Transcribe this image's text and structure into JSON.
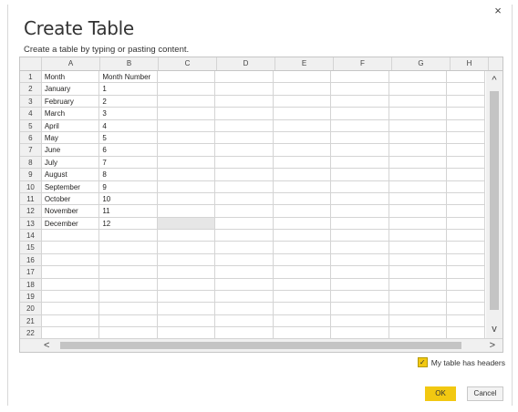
{
  "dialog": {
    "title": "Create Table",
    "subtitle": "Create a table by typing or pasting content.",
    "close_glyph": "×",
    "ok_label": "OK",
    "cancel_label": "Cancel",
    "headers_checkbox_label": "My table has headers",
    "headers_checked": true
  },
  "grid": {
    "columns": [
      "A",
      "B",
      "C",
      "D",
      "E",
      "F",
      "G",
      "H"
    ],
    "rows": [
      {
        "n": "1",
        "a": "Month",
        "b": "Month Number"
      },
      {
        "n": "2",
        "a": "January",
        "b": "1"
      },
      {
        "n": "3",
        "a": "February",
        "b": "2"
      },
      {
        "n": "4",
        "a": "March",
        "b": "3"
      },
      {
        "n": "5",
        "a": "April",
        "b": "4"
      },
      {
        "n": "6",
        "a": "May",
        "b": "5"
      },
      {
        "n": "7",
        "a": "June",
        "b": "6"
      },
      {
        "n": "8",
        "a": "July",
        "b": "7"
      },
      {
        "n": "9",
        "a": "August",
        "b": "8"
      },
      {
        "n": "10",
        "a": "September",
        "b": "9"
      },
      {
        "n": "11",
        "a": "October",
        "b": "10"
      },
      {
        "n": "12",
        "a": "November",
        "b": "11"
      },
      {
        "n": "13",
        "a": "December",
        "b": "12"
      },
      {
        "n": "14",
        "a": "",
        "b": ""
      },
      {
        "n": "15",
        "a": "",
        "b": ""
      },
      {
        "n": "16",
        "a": "",
        "b": ""
      },
      {
        "n": "17",
        "a": "",
        "b": ""
      },
      {
        "n": "18",
        "a": "",
        "b": ""
      },
      {
        "n": "19",
        "a": "",
        "b": ""
      },
      {
        "n": "20",
        "a": "",
        "b": ""
      },
      {
        "n": "21",
        "a": "",
        "b": ""
      },
      {
        "n": "22",
        "a": "",
        "b": ""
      }
    ],
    "selected_cell": "C13"
  },
  "scroll": {
    "up_glyph": "^",
    "down_glyph": "v",
    "left_glyph": "<",
    "right_glyph": ">"
  },
  "colors": {
    "accent": "#f2c811",
    "header_bg": "#f0f0f0",
    "grid_line": "#d4d4d4"
  }
}
